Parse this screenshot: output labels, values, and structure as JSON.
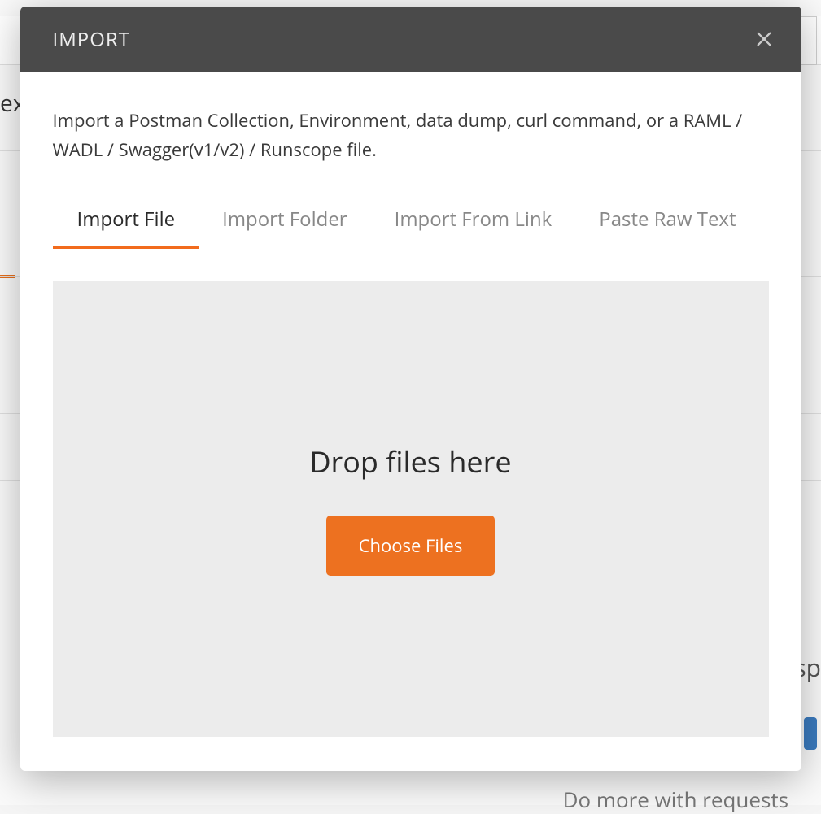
{
  "modal": {
    "title": "IMPORT",
    "description": "Import a Postman Collection, Environment, data dump, curl command, or a RAML / WADL / Swagger(v1/v2) / Runscope file.",
    "tabs": [
      {
        "label": "Import File",
        "active": true
      },
      {
        "label": "Import Folder",
        "active": false
      },
      {
        "label": "Import From Link",
        "active": false
      },
      {
        "label": "Paste Raw Text",
        "active": false
      }
    ],
    "dropzone": {
      "text": "Drop files here",
      "button_label": "Choose Files"
    }
  },
  "background": {
    "partial_text_left": "ex",
    "partial_text_right": "sp",
    "footer_hint": "Do more with requests"
  },
  "colors": {
    "accent": "#f26b1d",
    "header_bg": "#4a4a4a",
    "dropzone_bg": "#ececec"
  }
}
